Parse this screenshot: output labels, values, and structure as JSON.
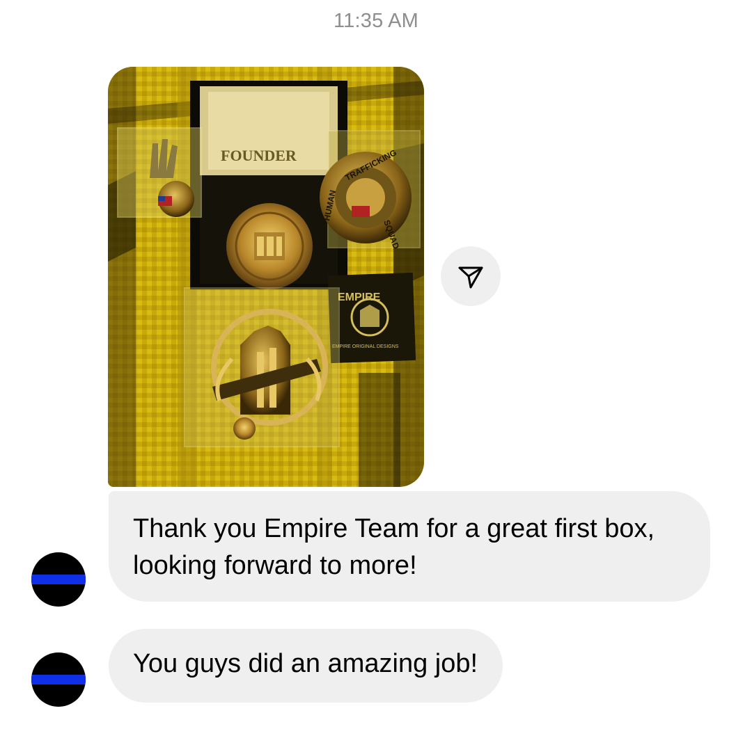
{
  "thread": {
    "timestamp": "11:35 AM",
    "photo_message": {
      "box_label": "FOUNDER",
      "coin_right_text_top": "TRAFFICKING",
      "coin_right_text_left": "HUMAN",
      "coin_right_text_bottom": "SQUAD",
      "card_brand": "EMPIRE",
      "card_footer": "EMPIRE ORIGINAL DESIGNS",
      "share_icon": "send-icon"
    },
    "messages": [
      {
        "text": "Thank you Empire Team for a great first box, looking forward to more!",
        "avatar_icon": "thin-blue-line-avatar"
      },
      {
        "text": "You guys did an amazing job!",
        "avatar_icon": "thin-blue-line-avatar"
      }
    ]
  },
  "colors": {
    "bubble_background": "#efefef",
    "timestamp_text": "#8e8e8e",
    "avatar_stripe": "#1030e8"
  }
}
